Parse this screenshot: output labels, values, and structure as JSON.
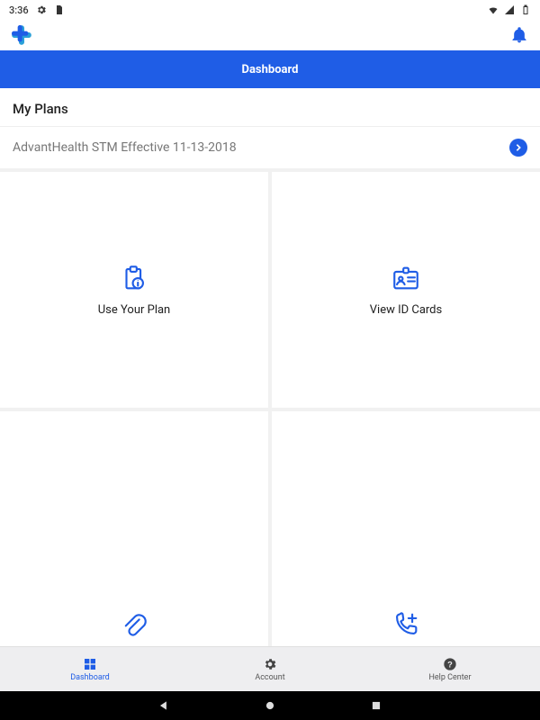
{
  "statusbar": {
    "time": "3:36"
  },
  "header": {
    "title": "Dashboard"
  },
  "section": {
    "title": "My Plans"
  },
  "plan": {
    "name": "AdvantHealth STM Effective 11-13-2018"
  },
  "cards": {
    "usePlan": "Use Your Plan",
    "viewId": "View ID Cards"
  },
  "bottomnav": {
    "dashboard": "Dashboard",
    "account": "Account",
    "help": "Help Center"
  },
  "colors": {
    "accent": "#1f5de6"
  }
}
